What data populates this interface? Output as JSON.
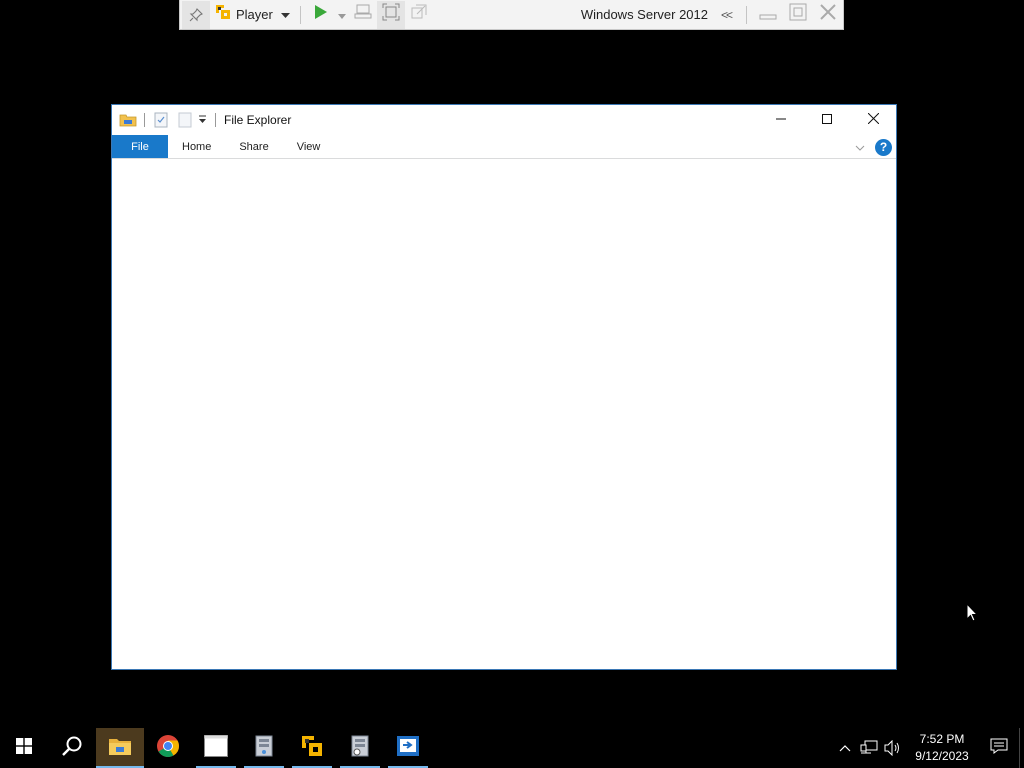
{
  "vm_toolbar": {
    "player_label": "Player",
    "vm_name": "Windows Server 2012",
    "collapse_glyph": "<<"
  },
  "explorer": {
    "title": "File Explorer",
    "tabs": [
      {
        "label": "File"
      },
      {
        "label": "Home"
      },
      {
        "label": "Share"
      },
      {
        "label": "View"
      }
    ],
    "help_glyph": "?"
  },
  "taskbar": {
    "apps": [
      {
        "name": "file-explorer-icon",
        "state": "active"
      },
      {
        "name": "chrome-icon",
        "state": "idle"
      },
      {
        "name": "blank-window-icon",
        "state": "running"
      },
      {
        "name": "server-manager-icon",
        "state": "running"
      },
      {
        "name": "vmware-player-icon",
        "state": "running"
      },
      {
        "name": "server-tools-icon",
        "state": "running"
      },
      {
        "name": "remote-desktop-icon",
        "state": "running"
      }
    ],
    "clock": {
      "time": "7:52 PM",
      "date": "9/12/2023"
    }
  },
  "colors": {
    "accent": "#1979ca",
    "taskbar_active": "#4c3a1e",
    "running_indicator": "#76b9ed",
    "play_green": "#3aa83a"
  }
}
